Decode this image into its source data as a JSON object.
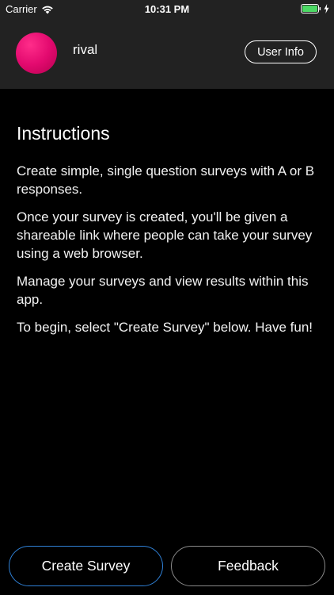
{
  "status_bar": {
    "carrier": "Carrier",
    "time": "10:31 PM"
  },
  "header": {
    "username": "rival",
    "user_info_label": "User Info",
    "avatar_color": "#e30a6f"
  },
  "instructions": {
    "title": "Instructions",
    "paragraphs": [
      "Create simple, single question surveys with A or B responses.",
      "Once your survey is created, you'll be given a shareable link where people can take your survey using a web browser.",
      "Manage your surveys and view results within this app.",
      "To begin, select \"Create Survey\" below.  Have fun!"
    ]
  },
  "buttons": {
    "create_survey": "Create Survey",
    "feedback": "Feedback"
  },
  "colors": {
    "background": "#000000",
    "header_background": "#222222",
    "create_border": "#2f80d6",
    "feedback_border": "#8a8a8a",
    "battery": "#4cd964"
  }
}
